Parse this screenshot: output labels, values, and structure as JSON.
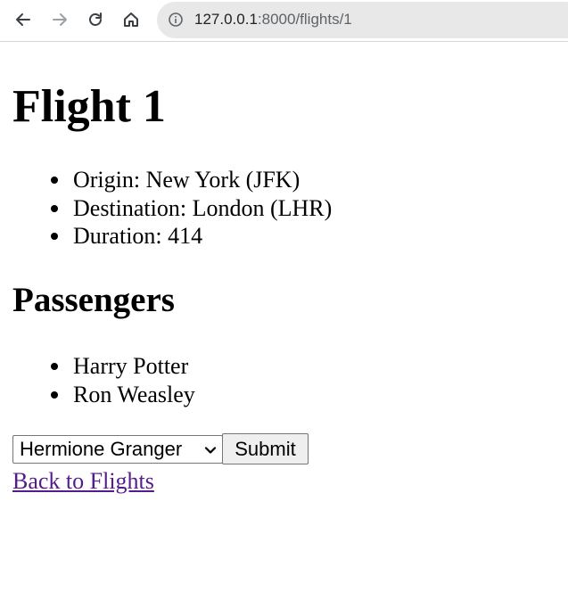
{
  "browser": {
    "url_host": "127.0.0.1",
    "url_path": ":8000/flights/1",
    "icons": [
      "back-arrow-icon",
      "forward-arrow-icon",
      "reload-icon",
      "home-icon",
      "info-icon"
    ]
  },
  "page": {
    "title": "Flight 1",
    "details": [
      "Origin: New York (JFK)",
      "Destination: London (LHR)",
      "Duration: 414"
    ],
    "passengers_heading": "Passengers",
    "passengers": [
      "Harry Potter",
      "Ron Weasley"
    ],
    "form": {
      "selected_passenger": "Hermione Granger",
      "submit_label": "Submit"
    },
    "back_link": "Back to Flights"
  },
  "colors": {
    "link_visited": "#551a8b",
    "omnibox_bg": "#e8e8e8"
  }
}
